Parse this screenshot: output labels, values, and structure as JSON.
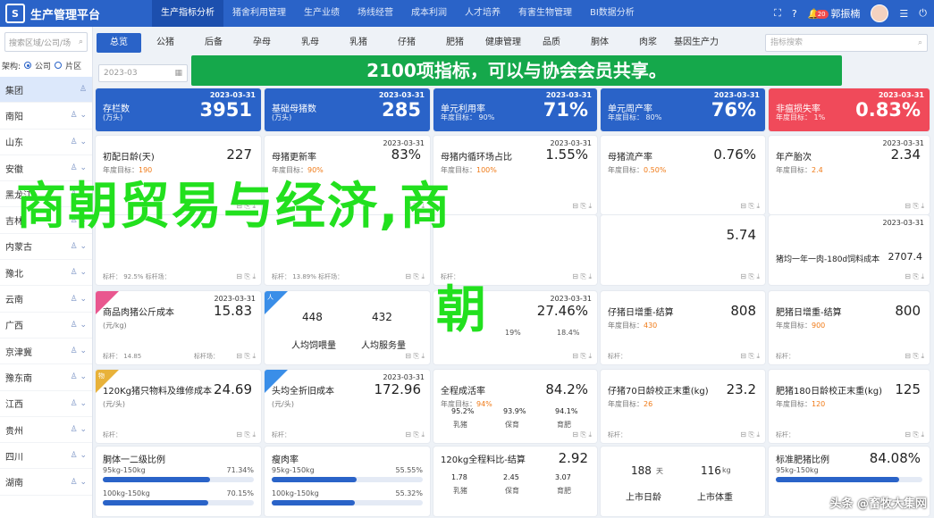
{
  "app": {
    "logo": "S",
    "title": "生产管理平台",
    "nav": [
      "生产指标分析",
      "猪舍利用管理",
      "生产业绩",
      "场线经营",
      "成本利润",
      "人才培养",
      "有害生物管理",
      "BI数据分析"
    ],
    "badge": "20",
    "user": "郭振楠"
  },
  "sidebar": {
    "search_placeholder": "搜索区域/公司/场",
    "filter": [
      "架构:",
      "公司",
      "片区"
    ],
    "items": [
      "集团",
      "南阳",
      "山东",
      "安徽",
      "黑龙江",
      "吉林",
      "内蒙古",
      "豫北",
      "云南",
      "广西",
      "京津冀",
      "豫东南",
      "江西",
      "贵州",
      "四川",
      "湖南"
    ]
  },
  "tabs": [
    "总览",
    "公猪",
    "后备",
    "孕母",
    "乳母",
    "乳猪",
    "仔猪",
    "肥猪",
    "健康管理",
    "品质",
    "胴体",
    "肉浆",
    "基因生产力"
  ],
  "search2": "指标搜索",
  "date": "2023-03",
  "banner": "2100项指标，可以与协会会员共享。",
  "row1": [
    {
      "date": "2023-03-31",
      "label": "存栏数",
      "sub": "(万头)",
      "value": "3951"
    },
    {
      "date": "2023-03-31",
      "label": "基础母猪数",
      "sub": "(万头)",
      "value": "285"
    },
    {
      "date": "2023-03-31",
      "label": "单元利用率",
      "sub": "年度目标： 90%",
      "value": "71%"
    },
    {
      "date": "2023-03-31",
      "label": "单元周产率",
      "sub": "年度目标： 80%",
      "value": "76%"
    },
    {
      "date": "2023-03-31",
      "label": "非瘟损失率",
      "sub": "年度目标： 1%",
      "value": "0.83%"
    }
  ],
  "row2": [
    {
      "date": "",
      "label": "初配日龄(天)",
      "value": "227",
      "sub": "年度目标：",
      "target": "190"
    },
    {
      "date": "2023-03-31",
      "label": "母猪更新率",
      "value": "83%",
      "sub": "年度目标：",
      "target": "90%"
    },
    {
      "date": "2023-03-31",
      "label": "母猪内循环场占比",
      "value": "1.55%",
      "sub": "年度目标：",
      "target": "100%"
    },
    {
      "date": "",
      "label": "母猪流产率",
      "value": "0.76%",
      "sub": "年度目标：",
      "target": "0.50%"
    },
    {
      "date": "2023-03-31",
      "label": "年产胎次",
      "value": "2.34",
      "sub": "年度目标：",
      "target": "2.4"
    }
  ],
  "row3": [
    {
      "date": "",
      "label": "",
      "value": "",
      "foot": "标杆： 92.5%  标杆场：",
      "sub": "",
      "target": ""
    },
    {
      "date": "",
      "label": "",
      "value": "",
      "foot": "标杆： 13.89%  标杆场：",
      "sub": "",
      "target": ""
    },
    {
      "date": "",
      "label": "",
      "value": "",
      "foot": "标杆：",
      "sub": "",
      "target": ""
    },
    {
      "date": "",
      "label": "",
      "value": "5.74",
      "foot": "",
      "sub": "",
      "target": ""
    },
    {
      "date": "2023-03-31",
      "label": "",
      "value": "",
      "foot": "",
      "sub": "",
      "target": ""
    }
  ],
  "row3extra": {
    "label5": "猪均一年一肉-180d饲料成本",
    "value5": "2707.4"
  },
  "row4": [
    {
      "corner": "",
      "date": "2023-03-31",
      "label": "商品肉猪公斤成本",
      "sub": "(元/kg)",
      "value": "15.83",
      "foot": "标杆： 14.85",
      "foot2": "标杆场："
    },
    {
      "corner": "人",
      "date": "",
      "label": "人均饲喂量",
      "sub": "",
      "value": "448",
      "label2": "人均服务量",
      "value2": "432",
      "foot": "",
      "foot2": ""
    },
    {
      "corner": "",
      "date": "2023-03-31",
      "label": "",
      "sub": "",
      "value": "27.46%",
      "extra": [
        "19%",
        "18.4%"
      ]
    },
    {
      "corner": "",
      "date": "",
      "label": "仔猪日增重-结算",
      "sub": "年度目标：",
      "value": "808",
      "target": "430",
      "foot": "标杆："
    },
    {
      "corner": "",
      "date": "",
      "label": "肥猪日增重-结算",
      "sub": "年度目标：",
      "value": "800",
      "target": "900",
      "foot": "标杆："
    }
  ],
  "row5": [
    {
      "corner": "物",
      "date": "",
      "label": "120Kg猪只物料及维修成本",
      "sub": "(元/头)",
      "value": "24.69",
      "foot": "标杆："
    },
    {
      "corner": "",
      "date": "2023-03-31",
      "label": "头均全折旧成本",
      "sub": "(元/头)",
      "value": "172.96",
      "foot": "标杆："
    },
    {
      "corner": "",
      "date": "",
      "label": "全程成活率",
      "sub": "年度目标：",
      "value": "84.2%",
      "target": "94%",
      "stats": [
        [
          "95.2%",
          "乳猪"
        ],
        [
          "93.9%",
          "保育"
        ],
        [
          "94.1%",
          "育肥"
        ]
      ]
    },
    {
      "corner": "",
      "date": "",
      "label": "仔猪70日龄校正末重(kg)",
      "sub": "年度目标：",
      "value": "23.2",
      "target": "26",
      "foot": "标杆："
    },
    {
      "corner": "",
      "date": "",
      "label": "肥猪180日龄校正末重(kg)",
      "sub": "年度目标：",
      "value": "125",
      "target": "120",
      "foot": "标杆："
    }
  ],
  "row6": [
    {
      "label": "胴体一二级比例",
      "b1": "95kg-150kg",
      "p1": "71.34%",
      "b2": "100kg-150kg",
      "p2": "70.15%",
      "f1": 0.71,
      "f2": 0.7
    },
    {
      "label": "瘦肉率",
      "b1": "95kg-150kg",
      "p1": "55.55%",
      "b2": "100kg-150kg",
      "p2": "55.32%",
      "f1": 0.56,
      "f2": 0.55
    },
    {
      "label": "120kg全程料比-结算",
      "value": "2.92",
      "stats": [
        [
          "1.78",
          "乳猪"
        ],
        [
          "2.45",
          "保育"
        ],
        [
          "3.07",
          "育肥"
        ]
      ]
    },
    {
      "v1": "188",
      "u1": "天",
      "v2": "116",
      "u2": "kg",
      "l1": "上市日龄",
      "l2": "上市体重"
    },
    {
      "label": "标准肥猪比例",
      "value": "84.08%",
      "b1": "95kg-150kg",
      "p1": ""
    }
  ],
  "overlay": {
    "line1": "商朝贸易与经济,商",
    "line2": "朝"
  },
  "watermark": "头条 @畜牧大集网",
  "colors": {
    "primary": "#2a63c8",
    "green": "#15a84b",
    "orange": "#f07b18",
    "red": "#f04a5a",
    "overlay": "#22e01e"
  }
}
